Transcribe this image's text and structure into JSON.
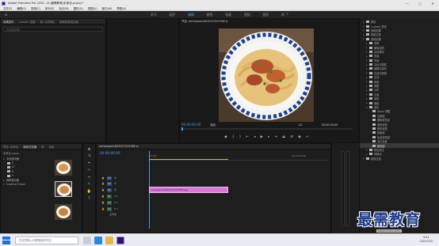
{
  "window": {
    "title": "Adobe Premiere Pro 2020 - D:\\最需教育\\未命名.prproj *",
    "controls": [
      "—",
      "□",
      "✕"
    ]
  },
  "menu": [
    "文件(F)",
    "编辑(E)",
    "剪辑(C)",
    "序列(S)",
    "标记(M)",
    "图形(G)",
    "视图(V)",
    "窗口(W)",
    "帮助(H)"
  ],
  "workspaces": {
    "tabs": [
      "学习",
      "组件",
      "编辑",
      "颜色",
      "效果",
      "音频",
      "图形",
      "库"
    ],
    "active_index": 2
  },
  "source_panel": {
    "tabs": [
      "效果控件",
      "Lumetri 范围",
      "源: (无剪辑)",
      "音频剪辑混合器"
    ],
    "search_placeholder": "(未选择剪辑)"
  },
  "program": {
    "title": "节目: mmexport1623237015786 ≡",
    "timecode_left": "00:00:00:00",
    "fit": "适合",
    "scale": "1/2",
    "timecode_right": "00:00:03:00"
  },
  "effects_tree": [
    {
      "label": "预设",
      "indent": 1,
      "open": false
    },
    {
      "label": "Lumetri 预设",
      "indent": 1,
      "open": false
    },
    {
      "label": "音频效果",
      "indent": 1,
      "open": false
    },
    {
      "label": "音频过渡",
      "indent": 1,
      "open": false
    },
    {
      "label": "视频效果",
      "indent": 1,
      "open": true
    },
    {
      "label": "变换",
      "indent": 2,
      "open": false
    },
    {
      "label": "图像控制",
      "indent": 2,
      "open": false
    },
    {
      "label": "实用程序",
      "indent": 2,
      "open": false
    },
    {
      "label": "扭曲",
      "indent": 2,
      "open": false
    },
    {
      "label": "时间",
      "indent": 2,
      "open": false
    },
    {
      "label": "杂色与颗粒",
      "indent": 2,
      "open": false
    },
    {
      "label": "模糊与锐化",
      "indent": 2,
      "open": false
    },
    {
      "label": "沉浸式视频",
      "indent": 2,
      "open": false
    },
    {
      "label": "生成",
      "indent": 2,
      "open": false
    },
    {
      "label": "视频",
      "indent": 2,
      "open": false
    },
    {
      "label": "调整",
      "indent": 2,
      "open": false
    },
    {
      "label": "过时",
      "indent": 2,
      "open": false
    },
    {
      "label": "过渡",
      "indent": 2,
      "open": false
    },
    {
      "label": "透视",
      "indent": 2,
      "open": false
    },
    {
      "label": "通道",
      "indent": 2,
      "open": false
    },
    {
      "label": "键控",
      "indent": 2,
      "open": true
    },
    {
      "label": "Alpha 调整",
      "indent": 3,
      "open": false
    },
    {
      "label": "亮度键",
      "indent": 3,
      "open": false
    },
    {
      "label": "图像遮罩键",
      "indent": 3,
      "open": false
    },
    {
      "label": "差值遮罩",
      "indent": 3,
      "open": false
    },
    {
      "label": "移除遮罩",
      "indent": 3,
      "open": false
    },
    {
      "label": "超级键",
      "indent": 3,
      "open": false
    },
    {
      "label": "轨道遮罩键",
      "indent": 3,
      "open": false
    },
    {
      "label": "非红色键",
      "indent": 3,
      "open": false
    },
    {
      "label": "颜色键",
      "indent": 3,
      "open": false
    },
    {
      "label": "颜色校正",
      "indent": 2,
      "open": false
    },
    {
      "label": "风格化",
      "indent": 2,
      "open": false
    },
    {
      "label": "视频过渡",
      "indent": 1,
      "open": false
    }
  ],
  "project": {
    "tabs": [
      "项目: 未命名",
      "媒体浏览器",
      "库",
      "信息"
    ],
    "path": "未命名.prproj",
    "items": [
      "本地驱动器",
      "C:",
      "D:",
      "E:",
      "F:",
      "网络驱动器",
      "Creative Cloud"
    ]
  },
  "timeline": {
    "title": "mmexport1623237015786 ≡",
    "timecode": "00:00:00:00",
    "ruler_start": ":00:00",
    "ruler_end": "00:00:05:00",
    "tracks": [
      "V3",
      "V2",
      "V1",
      "A1",
      "A2",
      "A3",
      "主声道"
    ],
    "clip_label": "mmexport1623237015786.jpg"
  },
  "taskbar": {
    "search_placeholder": "在这里输入你要搜索的内容",
    "time": "9:41",
    "date": "2021/7/15"
  },
  "watermark": {
    "text": "最需教育",
    "url": "www.zuixu.com"
  }
}
